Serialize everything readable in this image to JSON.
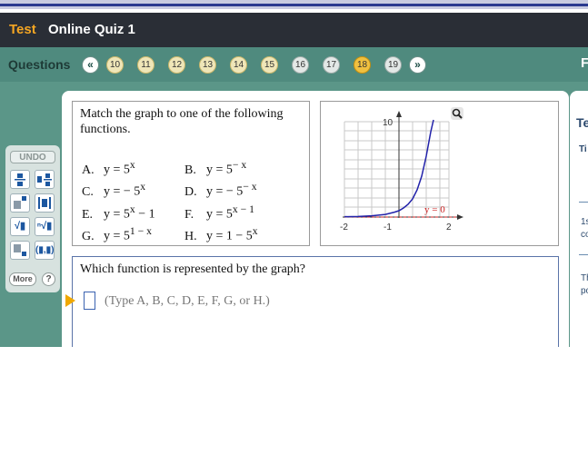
{
  "header": {
    "section": "Test",
    "title": "Online Quiz 1"
  },
  "nav": {
    "label": "Questions",
    "prev_icon": "double-chevron-left-icon",
    "next_icon": "double-chevron-right-icon",
    "questions": [
      {
        "num": "10",
        "state": "done"
      },
      {
        "num": "11",
        "state": "done"
      },
      {
        "num": "12",
        "state": "done"
      },
      {
        "num": "13",
        "state": "done"
      },
      {
        "num": "14",
        "state": "done"
      },
      {
        "num": "15",
        "state": "done"
      },
      {
        "num": "16",
        "state": "plain"
      },
      {
        "num": "17",
        "state": "plain"
      },
      {
        "num": "18",
        "state": "current"
      },
      {
        "num": "19",
        "state": "plain"
      }
    ],
    "right_edge_text": "F"
  },
  "tools": {
    "undo_label": "UNDO",
    "more_label": "More",
    "help_label": "?",
    "icons": [
      "fraction-icon",
      "mixed-number-icon",
      "exponent-icon",
      "absolute-value-icon",
      "square-root-icon",
      "nth-root-icon",
      "subscript-icon",
      "interval-icon"
    ]
  },
  "question": {
    "prompt": "Match the graph to one of the following functions.",
    "options_left": [
      {
        "letter": "A.",
        "expr": "y = 5",
        "sup": "x",
        "tail": ""
      },
      {
        "letter": "C.",
        "expr": "y = − 5",
        "sup": "x",
        "tail": ""
      },
      {
        "letter": "E.",
        "expr": "y = 5",
        "sup": "x",
        "tail": " − 1"
      },
      {
        "letter": "G.",
        "expr": "y = 5",
        "sup": "1 − x",
        "tail": ""
      }
    ],
    "options_right": [
      {
        "letter": "B.",
        "expr": "y = 5",
        "sup": "− x",
        "tail": ""
      },
      {
        "letter": "D.",
        "expr": "y = − 5",
        "sup": "− x",
        "tail": ""
      },
      {
        "letter": "F.",
        "expr": "y = 5",
        "sup": "x − 1",
        "tail": ""
      },
      {
        "letter": "H.",
        "expr": "y = 1 − 5",
        "sup": "x",
        "tail": ""
      }
    ]
  },
  "graph": {
    "y_tick": "10",
    "x_ticks": [
      "-2",
      "-1",
      "2"
    ],
    "asymptote_label": "y = 0",
    "zoom_icon": "magnifier-icon",
    "curve_color": "#2222aa",
    "asymptote_color": "#cc2222"
  },
  "answer": {
    "question": "Which function is represented by the graph?",
    "hint": "(Type A, B, C, D, E, F, G, or H.)",
    "value": ""
  },
  "side_panel": {
    "texts": [
      "Te",
      "Ti",
      "1s",
      "co",
      "Th",
      "po"
    ]
  },
  "colors": {
    "title_bar": "#2a2e36",
    "accent": "#f5a623",
    "nav_bar": "#4f8a7e",
    "current_question": "#f0c040"
  }
}
